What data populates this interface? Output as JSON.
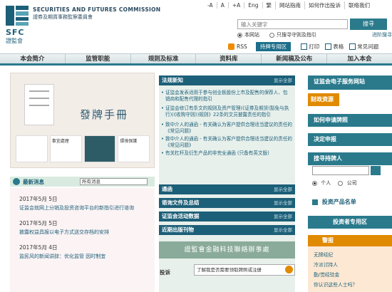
{
  "header": {
    "logo_en": "SECURITIES AND FUTURES COMMISSION",
    "logo_zh": "證券及期貨事務監察委員會",
    "sfc_en": "SFC",
    "sfc_zh": "證監會",
    "font_small": "-A",
    "font_mid": "A",
    "font_large": "+A",
    "lang_en": "Eng",
    "lang_tc": "繁",
    "site_map": "网站指南",
    "staff": "如何作出投诉",
    "contact": "联络我们"
  },
  "search": {
    "placeholder": "输入关键字",
    "button": "搜寻",
    "scope_this": "本网站",
    "scope_guide": "只搜寻守则及指引",
    "advanced": "进阶搜寻"
  },
  "utility": {
    "rss": "RSS",
    "special": "持牌专用区",
    "print": "打印",
    "table": "表格",
    "faq": "常见问题"
  },
  "nav": [
    "本会简介",
    "监管职能",
    "规则及标准",
    "资料库",
    "新闻稿及公布",
    "加入本会"
  ],
  "hero": {
    "title": "發牌手冊",
    "thumb1": "",
    "thumb2": "事宜處理",
    "thumb3": "",
    "thumb4": "環境保護"
  },
  "news": {
    "header": "最新消息",
    "filter": "所有消息",
    "items": [
      {
        "date": "2017年5月 5日",
        "text": "证监会就网上分销及投资咨询平台的新指引进行谘询"
      },
      {
        "date": "2017年5月 5日",
        "text": "披露权益具报以电子方式送交存档的安排"
      },
      {
        "date": "2017年5月 4日",
        "text": "监民风的新闻讲辞：优化监管 因时制宜"
      }
    ]
  },
  "regulation": {
    "header": "法规新知",
    "show_all": "显示全部",
    "items": [
      "证监会发表适用于参与创业板股份上市及配售的保荐人、包销商和配售代理的指引",
      "证监会修订有条文的规则及资产管理(《证券及期货(豁免与执行)(《收购守则》)规则》22条的文员披露责任的指引",
      "致中介人的通函 - 有关确认为客户提供合理适当建议的责任的《常见问题》",
      "致中介人的通函 - 有关确认为客户提供合理适当建议的责任的《常见问题》",
      "有关杠杆及衍生产品的非完全通函 (只备有英文版)"
    ],
    "bars": [
      {
        "label": "通函",
        "show_all": "显示全部"
      },
      {
        "label": "谘询文件及总结",
        "show_all": "显示全部"
      },
      {
        "label": "证监会活动数据",
        "show_all": "显示全部"
      },
      {
        "label": "近期出版刊物",
        "show_all": "显示全部"
      }
    ],
    "banner": "證監會金融科技聯絡辦事處",
    "complaint_label": "投诉",
    "complaint_text": "了解我是否需要领取牌照或注册"
  },
  "right": {
    "eservice": "证监会电子服务网站",
    "stub_top": "财政资源",
    "licence": "如何申请牌照",
    "decision": "决定申报",
    "search_holder": "搜寻持牌人",
    "r_person": "个人",
    "r_company": "公司",
    "products": "投资产品名单",
    "investor": "投资者专用区",
    "alert_head": "警报",
    "alerts": [
      "无牌经纪",
      "冷淡讨持人",
      "勤/觉经验金",
      "你认识这些人士吗？"
    ]
  }
}
